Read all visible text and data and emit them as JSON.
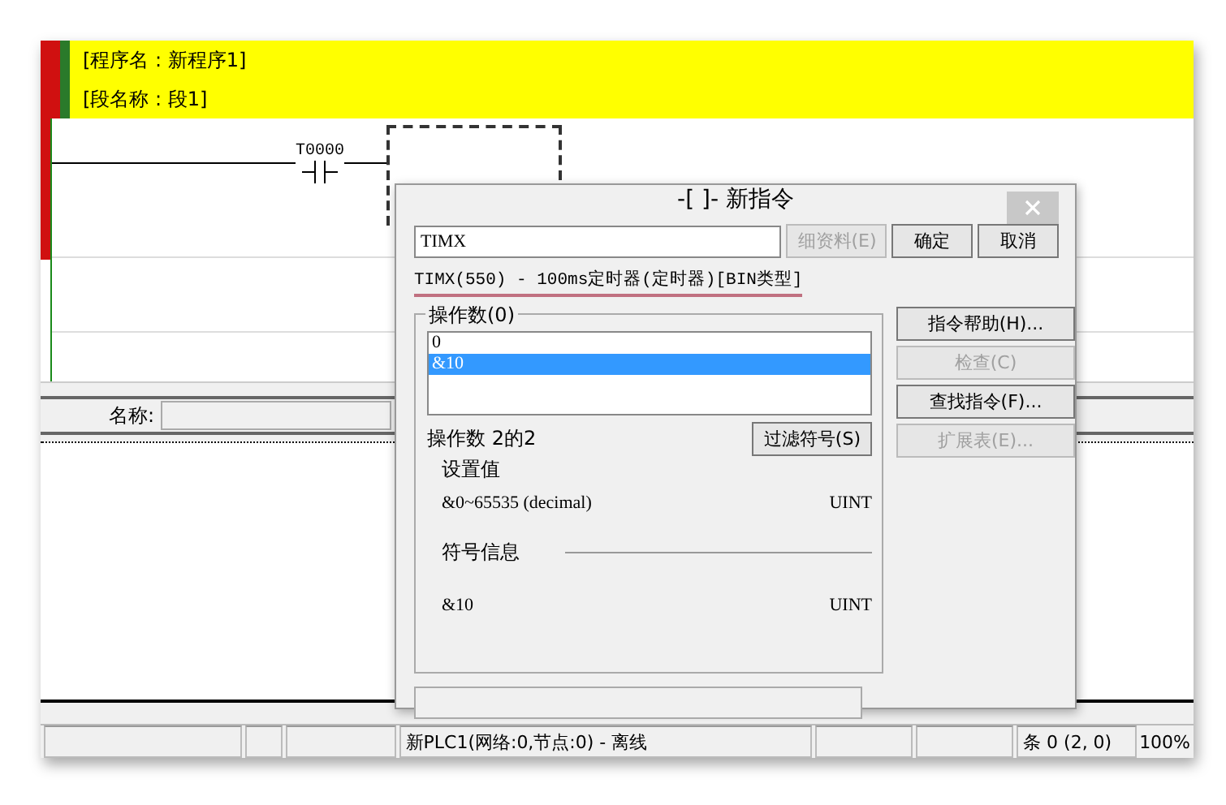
{
  "ladder": {
    "program_name": "[程序名 : 新程序1]",
    "section_name": "[段名称 : 段1]",
    "contact_label": "T0000"
  },
  "name_bar": {
    "label": "名称:"
  },
  "dialog": {
    "title": "-[ ]- 新指令",
    "input_value": "TIMX",
    "buttons": [
      {
        "label": "细资料(E)",
        "disabled": true
      },
      {
        "label": "确定",
        "disabled": false
      },
      {
        "label": "取消",
        "disabled": false
      }
    ],
    "description": "TIMX(550) - 100ms定时器(定时器)[BIN类型]",
    "operands_group": "操作数(0)",
    "operands": [
      {
        "text": "0",
        "selected": false
      },
      {
        "text": "&10",
        "selected": true
      }
    ],
    "side_buttons": [
      {
        "label": "指令帮助(H)...",
        "disabled": false
      },
      {
        "label": "检查(C)",
        "disabled": true
      },
      {
        "label": "查找指令(F)...",
        "disabled": false
      },
      {
        "label": "扩展表(E)...",
        "disabled": true
      }
    ],
    "filter_button": "过滤符号(S)",
    "operand_count": "操作数 2的2",
    "setting_label": "设置值",
    "range": "&0~65535 (decimal)",
    "range_type": "UINT",
    "symbol_label": "符号信息",
    "symbol_value": "&10",
    "symbol_type": "UINT"
  },
  "status_bar": {
    "cells": [
      "新PLC1(网络:0,节点:0) - 离线",
      "条 0 (2, 0)",
      "100%"
    ]
  }
}
